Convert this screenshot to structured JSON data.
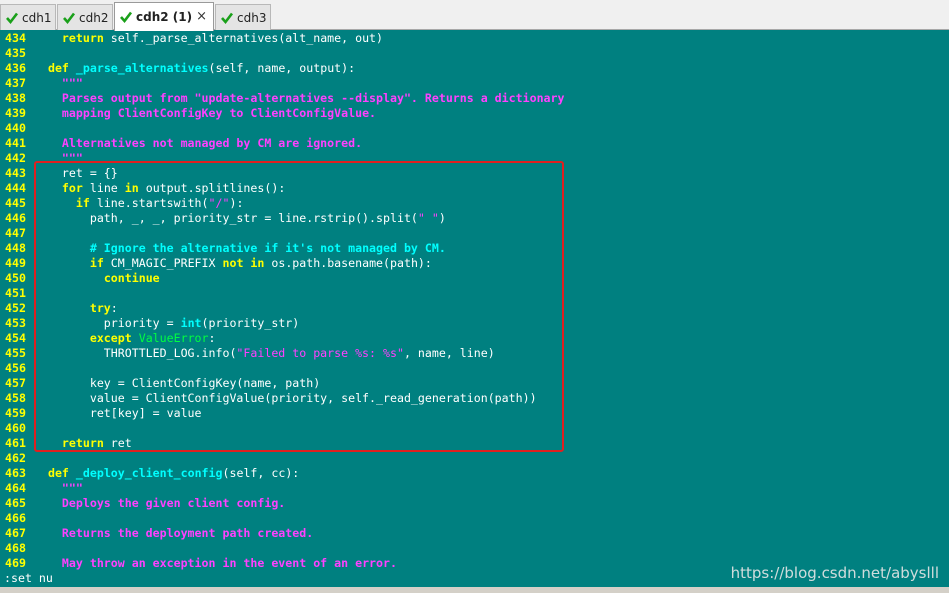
{
  "tabs": [
    {
      "label": "cdh1",
      "active": false
    },
    {
      "label": "cdh2",
      "active": false
    },
    {
      "label": "cdh2 (1)",
      "active": true
    },
    {
      "label": "cdh3",
      "active": false
    }
  ],
  "close_glyph": "×",
  "command_line": ":set nu",
  "watermark": "https://blog.csdn.net/abyslll",
  "colors": {
    "background": "#008080",
    "line_number": "#ffff00",
    "keyword": "#ffff00",
    "docstring": "#ff40ff",
    "highlight_box": "#e02020"
  },
  "lines": [
    {
      "num": "434",
      "segs": [
        [
          "",
          "    "
        ],
        [
          "kw",
          "return"
        ],
        [
          "",
          " self._parse_alternatives(alt_name, out)"
        ]
      ]
    },
    {
      "num": "435",
      "segs": []
    },
    {
      "num": "436",
      "segs": [
        [
          "",
          "  "
        ],
        [
          "kw",
          "def"
        ],
        [
          "",
          " "
        ],
        [
          "fn",
          "_parse_alternatives"
        ],
        [
          "",
          "(self, name, output):"
        ]
      ]
    },
    {
      "num": "437",
      "segs": [
        [
          "",
          "    "
        ],
        [
          "doc",
          "\"\"\""
        ]
      ]
    },
    {
      "num": "438",
      "segs": [
        [
          "",
          "    "
        ],
        [
          "doc",
          "Parses output from \"update-alternatives --display\". Returns a dictionary"
        ]
      ]
    },
    {
      "num": "439",
      "segs": [
        [
          "",
          "    "
        ],
        [
          "doc",
          "mapping ClientConfigKey to ClientConfigValue."
        ]
      ]
    },
    {
      "num": "440",
      "segs": []
    },
    {
      "num": "441",
      "segs": [
        [
          "",
          "    "
        ],
        [
          "doc",
          "Alternatives not managed by CM are ignored."
        ]
      ]
    },
    {
      "num": "442",
      "segs": [
        [
          "",
          "    "
        ],
        [
          "doc",
          "\"\"\""
        ]
      ]
    },
    {
      "num": "443",
      "segs": [
        [
          "",
          "    ret = {}"
        ]
      ]
    },
    {
      "num": "444",
      "segs": [
        [
          "",
          "    "
        ],
        [
          "kw",
          "for"
        ],
        [
          "",
          " line "
        ],
        [
          "kw",
          "in"
        ],
        [
          "",
          " output.splitlines():"
        ]
      ]
    },
    {
      "num": "445",
      "segs": [
        [
          "",
          "      "
        ],
        [
          "kw",
          "if"
        ],
        [
          "",
          " line.startswith("
        ],
        [
          "str",
          "\"/\""
        ],
        [
          "",
          "):"
        ]
      ]
    },
    {
      "num": "446",
      "segs": [
        [
          "",
          "        path, _, _, priority_str = line.rstrip().split("
        ],
        [
          "str",
          "\" \""
        ],
        [
          "",
          ")"
        ]
      ]
    },
    {
      "num": "447",
      "segs": []
    },
    {
      "num": "448",
      "segs": [
        [
          "",
          "        "
        ],
        [
          "cmt",
          "# Ignore the alternative if it's not managed by CM."
        ]
      ]
    },
    {
      "num": "449",
      "segs": [
        [
          "",
          "        "
        ],
        [
          "kw",
          "if"
        ],
        [
          "",
          " CM_MAGIC_PREFIX "
        ],
        [
          "kw",
          "not in"
        ],
        [
          "",
          " os.path.basename(path):"
        ]
      ]
    },
    {
      "num": "450",
      "segs": [
        [
          "",
          "          "
        ],
        [
          "kw",
          "continue"
        ]
      ]
    },
    {
      "num": "451",
      "segs": []
    },
    {
      "num": "452",
      "segs": [
        [
          "",
          "        "
        ],
        [
          "kw",
          "try"
        ],
        [
          "",
          ":"
        ]
      ]
    },
    {
      "num": "453",
      "segs": [
        [
          "",
          "          priority = "
        ],
        [
          "bi",
          "int"
        ],
        [
          "",
          "(priority_str)"
        ]
      ]
    },
    {
      "num": "454",
      "segs": [
        [
          "",
          "        "
        ],
        [
          "kw",
          "except"
        ],
        [
          "",
          " "
        ],
        [
          "exc",
          "ValueError"
        ],
        [
          "",
          ":"
        ]
      ]
    },
    {
      "num": "455",
      "segs": [
        [
          "",
          "          THROTTLED_LOG.info("
        ],
        [
          "str",
          "\"Failed to parse %s: %s\""
        ],
        [
          "",
          ", name, line)"
        ]
      ]
    },
    {
      "num": "456",
      "segs": []
    },
    {
      "num": "457",
      "segs": [
        [
          "",
          "        key = ClientConfigKey(name, path)"
        ]
      ]
    },
    {
      "num": "458",
      "segs": [
        [
          "",
          "        value = ClientConfigValue(priority, self._read_generation(path))"
        ]
      ]
    },
    {
      "num": "459",
      "segs": [
        [
          "",
          "        ret[key] = value"
        ]
      ]
    },
    {
      "num": "460",
      "segs": []
    },
    {
      "num": "461",
      "segs": [
        [
          "",
          "    "
        ],
        [
          "kw",
          "return"
        ],
        [
          "",
          " ret"
        ]
      ]
    },
    {
      "num": "462",
      "segs": []
    },
    {
      "num": "463",
      "segs": [
        [
          "",
          "  "
        ],
        [
          "kw",
          "def"
        ],
        [
          "",
          " "
        ],
        [
          "fn",
          "_deploy_client_config"
        ],
        [
          "",
          "(self, cc):"
        ]
      ]
    },
    {
      "num": "464",
      "segs": [
        [
          "",
          "    "
        ],
        [
          "doc",
          "\"\"\""
        ]
      ]
    },
    {
      "num": "465",
      "segs": [
        [
          "",
          "    "
        ],
        [
          "doc",
          "Deploys the given client config."
        ]
      ]
    },
    {
      "num": "466",
      "segs": []
    },
    {
      "num": "467",
      "segs": [
        [
          "",
          "    "
        ],
        [
          "doc",
          "Returns the deployment path created."
        ]
      ]
    },
    {
      "num": "468",
      "segs": []
    },
    {
      "num": "469",
      "segs": [
        [
          "",
          "    "
        ],
        [
          "doc",
          "May throw an exception in the event of an error."
        ]
      ]
    }
  ]
}
